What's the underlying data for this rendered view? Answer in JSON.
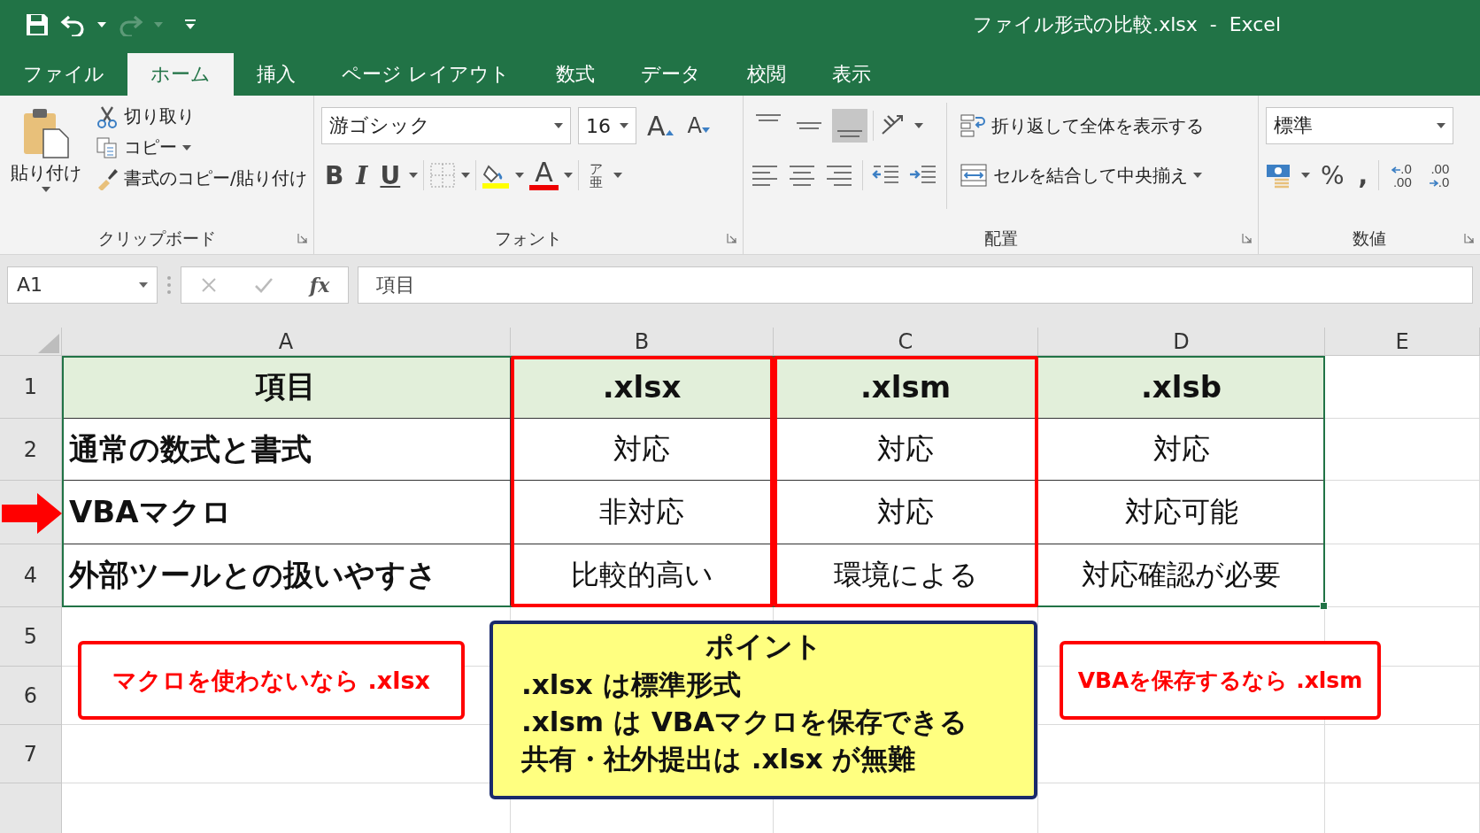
{
  "title_bar": {
    "title": "ファイル形式の比較.xlsx  -  Excel",
    "redo_disabled": true
  },
  "tabs": [
    {
      "label": "ファイル",
      "selected": false
    },
    {
      "label": "ホーム",
      "selected": true
    },
    {
      "label": "挿入",
      "selected": false
    },
    {
      "label": "ページ レイアウト",
      "selected": false
    },
    {
      "label": "数式",
      "selected": false
    },
    {
      "label": "データ",
      "selected": false
    },
    {
      "label": "校閲",
      "selected": false
    },
    {
      "label": "表示",
      "selected": false
    }
  ],
  "ribbon": {
    "clipboard": {
      "paste": "貼り付け",
      "cut": "切り取り",
      "copy": "コピー",
      "format_painter": "書式のコピー/貼り付け",
      "label": "クリップボード"
    },
    "font": {
      "name": "游ゴシック",
      "size": "16",
      "grow": "A",
      "shrink": "A",
      "bold": "B",
      "italic": "I",
      "underline": "U",
      "font_color": "A",
      "phonetic_top": "ア",
      "phonetic_bottom": "亜",
      "label": "フォント"
    },
    "alignment": {
      "vertical": [
        {
          "selected": false
        },
        {
          "selected": false
        },
        {
          "selected": true
        }
      ],
      "wrap": "折り返して全体を表示する",
      "merge": "セルを結合して中央揃え",
      "label": "配置"
    },
    "number": {
      "format": "標準",
      "percent": "%",
      "comma": ",",
      "decimals": [
        {
          "kind": "increase",
          "top": ".0",
          "bottom": ".00"
        },
        {
          "kind": "decrease",
          "top": ".00",
          "bottom": ".0"
        }
      ],
      "label": "数値"
    }
  },
  "formula_bar": {
    "name_box": "A1",
    "fx": "fx",
    "formula": "項目"
  },
  "sheet": {
    "columns": [
      {
        "label": "A",
        "highlighted": false
      },
      {
        "label": "B",
        "highlighted": true
      },
      {
        "label": "C",
        "highlighted": true
      },
      {
        "label": "D",
        "highlighted": false
      },
      {
        "label": "E",
        "highlighted": false
      }
    ],
    "rows": [
      {
        "number": "1",
        "kind": "header",
        "marked": false,
        "cells": [
          "項目",
          ".xlsx",
          ".xlsm",
          ".xlsb"
        ]
      },
      {
        "number": "2",
        "kind": "body",
        "marked": false,
        "cells": [
          "通常の数式と書式",
          "対応",
          "対応",
          "対応"
        ]
      },
      {
        "kind": "body",
        "marked": true,
        "cells": [
          "VBAマクロ",
          "非対応",
          "対応",
          "対応可能"
        ]
      },
      {
        "number": "4",
        "kind": "body",
        "marked": false,
        "cells": [
          "外部ツールとの扱いやすさ",
          "比較的高い",
          "環境による",
          "対応確認が必要"
        ]
      },
      {
        "number": "5",
        "kind": "empty",
        "marked": false
      },
      {
        "number": "6",
        "kind": "empty",
        "marked": false
      },
      {
        "number": "7",
        "kind": "empty",
        "marked": false
      }
    ]
  },
  "notes": [
    {
      "kind": "callout",
      "text": "マクロを使わないなら .xlsx"
    },
    {
      "kind": "point",
      "title": "ポイント",
      "lines": [
        ".xlsx は標準形式",
        ".xlsm は VBAマクロを保存できる",
        "共有・社外提出は .xlsx が無難"
      ]
    },
    {
      "kind": "callout",
      "text": "VBAを保存するなら .xlsm"
    }
  ]
}
